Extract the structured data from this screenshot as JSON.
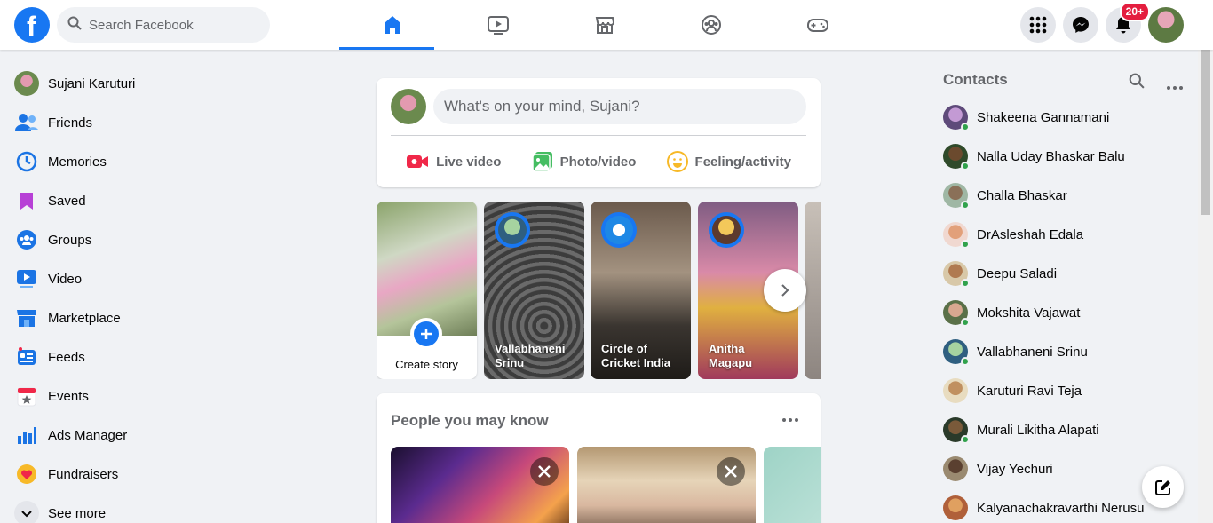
{
  "header": {
    "search_placeholder": "Search Facebook",
    "notification_badge": "20+"
  },
  "user": {
    "name": "Sujani Karuturi"
  },
  "left_nav": [
    {
      "label": "Sujani Karuturi",
      "icon": "profile-avatar"
    },
    {
      "label": "Friends",
      "icon": "friends-icon"
    },
    {
      "label": "Memories",
      "icon": "memories-icon"
    },
    {
      "label": "Saved",
      "icon": "saved-icon"
    },
    {
      "label": "Groups",
      "icon": "groups-icon"
    },
    {
      "label": "Video",
      "icon": "video-icon"
    },
    {
      "label": "Marketplace",
      "icon": "marketplace-icon"
    },
    {
      "label": "Feeds",
      "icon": "feeds-icon"
    },
    {
      "label": "Events",
      "icon": "events-icon"
    },
    {
      "label": "Ads Manager",
      "icon": "ads-manager-icon"
    },
    {
      "label": "Fundraisers",
      "icon": "fundraisers-icon"
    },
    {
      "label": "See more",
      "icon": "chevron-down-icon"
    }
  ],
  "composer": {
    "placeholder": "What's on your mind, Sujani?",
    "actions": [
      {
        "label": "Live video",
        "color": "#f02849"
      },
      {
        "label": "Photo/video",
        "color": "#45bd62"
      },
      {
        "label": "Feeling/activity",
        "color": "#f7b928"
      }
    ]
  },
  "stories": {
    "create_label": "Create story",
    "items": [
      {
        "name": "Vallabhaneni Srinu"
      },
      {
        "name": "Circle of Cricket India"
      },
      {
        "name": "Anitha Magapu"
      }
    ]
  },
  "pymk": {
    "title": "People you may know"
  },
  "contacts": {
    "title": "Contacts",
    "items": [
      {
        "name": "Shakeena Gannamani"
      },
      {
        "name": "Nalla Uday Bhaskar Balu"
      },
      {
        "name": "Challa Bhaskar"
      },
      {
        "name": "DrAsleshah Edala"
      },
      {
        "name": "Deepu Saladi"
      },
      {
        "name": "Mokshita Vajawat"
      },
      {
        "name": "Vallabhaneni Srinu"
      },
      {
        "name": "Karuturi Ravi Teja"
      },
      {
        "name": "Murali Likitha Alapati"
      },
      {
        "name": "Vijay Yechuri"
      },
      {
        "name": "Kalyanachakravarthi Nerusu"
      }
    ]
  },
  "colors": {
    "accent": "#1877f2",
    "background": "#f0f2f5"
  }
}
